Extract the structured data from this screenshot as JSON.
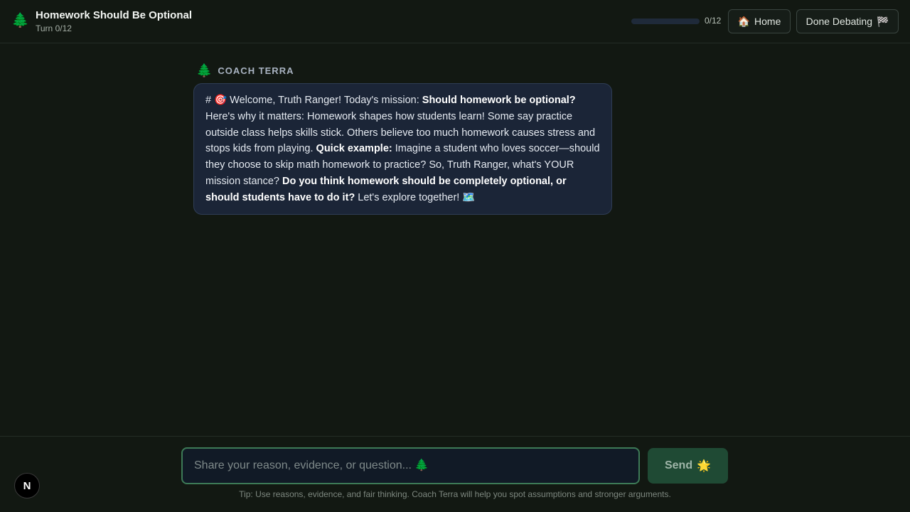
{
  "header": {
    "icon": "🌲",
    "title": "Homework Should Be Optional",
    "turn": "Turn 0/12",
    "progress_fraction": 0,
    "progress_label": "0/12",
    "home_icon": "🏠",
    "home_label": "Home",
    "done_label": "Done Debating",
    "done_icon": "🏁"
  },
  "chat": {
    "speaker_icon": "🌲",
    "speaker_name": "COACH TERRA",
    "message": {
      "p1": "# 🎯 Welcome, Truth Ranger! Today's mission: ",
      "b1": "Should homework be optional?",
      "p2": " Here's why it matters: Homework shapes how students learn! Some say practice outside class helps skills stick. Others believe too much homework causes stress and stops kids from playing. ",
      "b2": "Quick example:",
      "p3": " Imagine a student who loves soccer—should they choose to skip math homework to practice? So, Truth Ranger, what's YOUR mission stance? ",
      "b3": "Do you think homework should be completely optional, or should students have to do it?",
      "p4": " Let's explore together! 🗺️"
    }
  },
  "composer": {
    "placeholder": "Share your reason, evidence, or question... 🌲",
    "value": "",
    "send_label": "Send",
    "send_icon": "🌟",
    "tip": "Tip: Use reasons, evidence, and fair thinking. Coach Terra will help you spot assumptions and stronger arguments."
  },
  "badge": {
    "letter": "N"
  },
  "colors": {
    "background": "#121812",
    "bubble": "#1b2537",
    "accent": "#3d7a57",
    "send": "#1f4a34"
  }
}
